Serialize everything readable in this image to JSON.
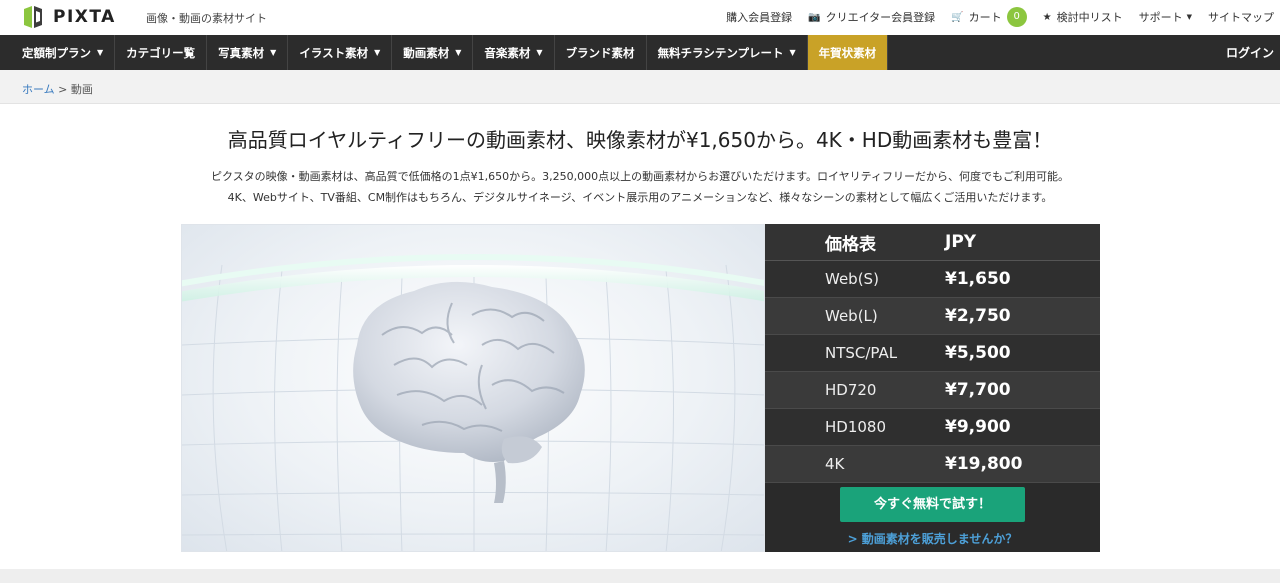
{
  "brand": {
    "name": "PIXTA",
    "tagline": "画像・動画の素材サイト"
  },
  "toplinks": {
    "register": "購入会員登録",
    "creator": "クリエイター会員登録",
    "cart": "カート",
    "cart_count": "0",
    "wishlist": "検討中リスト",
    "support": "サポート",
    "sitemap": "サイトマップ"
  },
  "nav": {
    "items": [
      {
        "label": "定額制プラン",
        "dropdown": true
      },
      {
        "label": "カテゴリー覧",
        "dropdown": false
      },
      {
        "label": "写真素材",
        "dropdown": true
      },
      {
        "label": "イラスト素材",
        "dropdown": true
      },
      {
        "label": "動画素材",
        "dropdown": true
      },
      {
        "label": "音楽素材",
        "dropdown": true
      },
      {
        "label": "ブランド素材",
        "dropdown": false
      },
      {
        "label": "無料チラシテンプレート",
        "dropdown": true
      },
      {
        "label": "年賀状素材",
        "dropdown": false,
        "highlight": true
      }
    ],
    "login": "ログイン",
    "highlight_color": "#c9a227"
  },
  "breadcrumb": {
    "home": "ホーム",
    "separator": ">",
    "current": "動画"
  },
  "headline": "高品質ロイヤルティフリーの動画素材、映像素材が¥1,650から。4K・HD動画素材も豊富！",
  "description": {
    "line1": "ピクスタの映像・動画素材は、高品質で低価格の1点¥1,650から。3,250,000点以上の動画素材からお選びいただけます。ロイヤリティフリーだから、何度でもご利用可能。",
    "line2": "4K、Webサイト、TV番組、CM制作はもちろん、デジタルサイネージ、イベント展示用のアニメーションなど、様々なシーンの素材として幅広くご活用いただけます。"
  },
  "price_table": {
    "header": {
      "label": "価格表",
      "currency": "JPY"
    },
    "rows": [
      {
        "size": "Web(S)",
        "price": "¥1,650"
      },
      {
        "size": "Web(L)",
        "price": "¥2,750"
      },
      {
        "size": "NTSC/PAL",
        "price": "¥5,500"
      },
      {
        "size": "HD720",
        "price": "¥7,700"
      },
      {
        "size": "HD1080",
        "price": "¥9,900"
      },
      {
        "size": "4K",
        "price": "¥19,800"
      }
    ],
    "cta": "今すぐ無料で試す！",
    "sell_link": "> 動画素材を販売しませんか？",
    "cta_color": "#1aa37a"
  },
  "hero": {
    "icon": "brain-icon"
  }
}
